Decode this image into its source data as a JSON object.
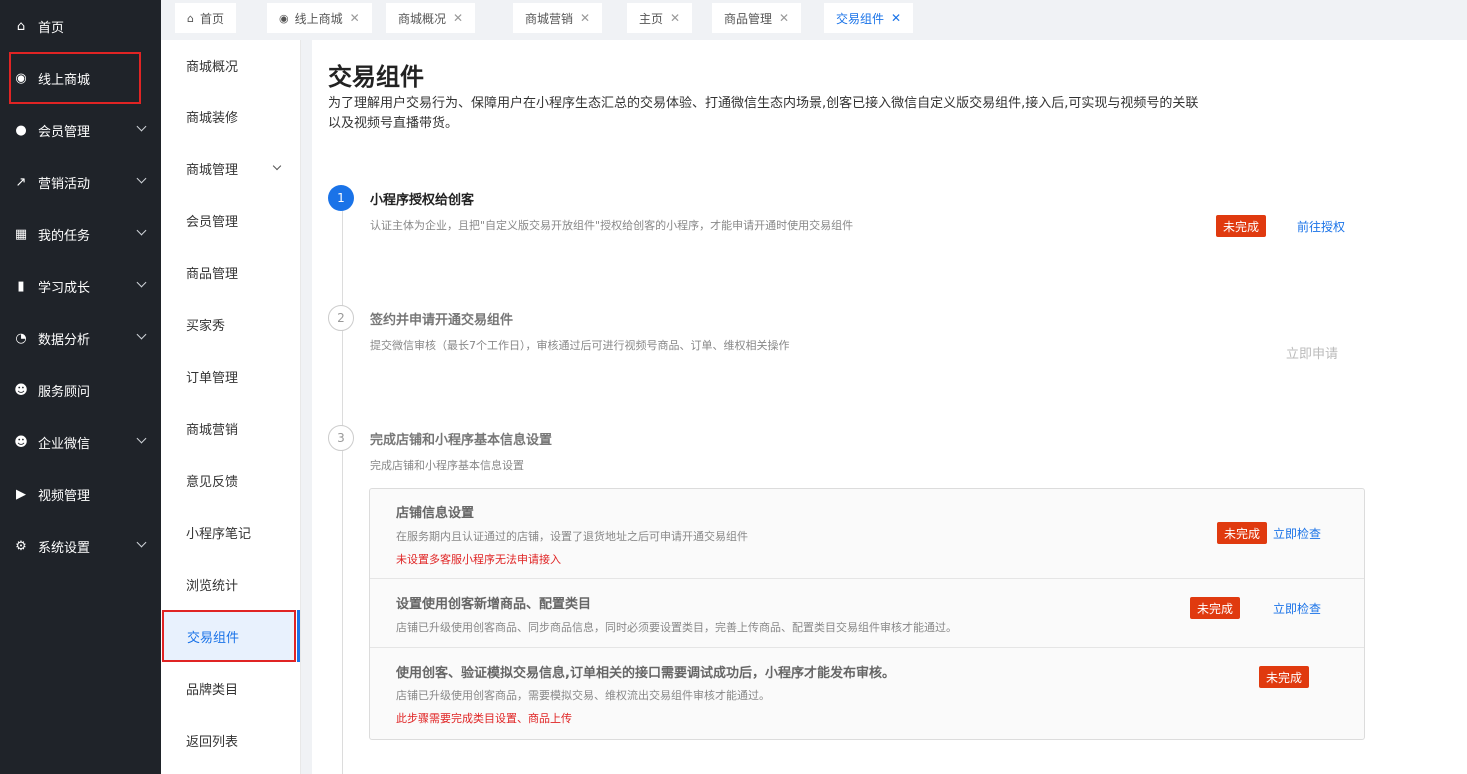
{
  "nav1": [
    {
      "label": "首页",
      "icon": "home-icon"
    },
    {
      "label": "线上商城",
      "icon": "store-icon"
    },
    {
      "label": "会员管理",
      "icon": "user-icon"
    },
    {
      "label": "营销活动",
      "icon": "trend-icon"
    },
    {
      "label": "我的任务",
      "icon": "grid-icon"
    },
    {
      "label": "学习成长",
      "icon": "book-icon"
    },
    {
      "label": "数据分析",
      "icon": "pie-icon"
    },
    {
      "label": "服务顾问",
      "icon": "people-icon"
    },
    {
      "label": "企业微信",
      "icon": "people-icon"
    },
    {
      "label": "视频管理",
      "icon": "video-icon"
    },
    {
      "label": "系统设置",
      "icon": "gear-icon"
    }
  ],
  "nav2": [
    "商城概况",
    "商城装修",
    "商城管理",
    "会员管理",
    "商品管理",
    "买家秀",
    "订单管理",
    "商城营销",
    "意见反馈",
    "小程序笔记",
    "浏览统计",
    "交易组件",
    "品牌类目",
    "返回列表"
  ],
  "tabs": [
    "首页",
    "线上商城",
    "商城概况",
    "商城营销",
    "主页",
    "商品管理",
    "交易组件"
  ],
  "page": {
    "title": "交易组件",
    "desc": "为了理解用户交易行为、保障用户在小程序生态汇总的交易体验、打通微信生态内场景,创客已接入微信自定义版交易组件,接入后,可实现与视频号的关联以及视频号直播带货。"
  },
  "steps": [
    {
      "num": "1",
      "title": "小程序授权给创客",
      "sub": "认证主体为企业，且把\"自定义版交易开放组件\"授权给创客的小程序，才能申请开通时使用交易组件",
      "badge": "未完成",
      "link": "前往授权"
    },
    {
      "num": "2",
      "title": "签约并申请开通交易组件",
      "sub": "提交微信审核（最长7个工作日），审核通过后可进行视频号商品、订单、维权相关操作",
      "link": "立即申请"
    },
    {
      "num": "3",
      "title": "完成店铺和小程序基本信息设置",
      "sub": "完成店铺和小程序基本信息设置"
    }
  ],
  "rows": [
    {
      "title": "店铺信息设置",
      "sub": "在服务期内且认证通过的店铺，设置了退货地址之后可申请开通交易组件",
      "warn": "未设置多客服小程序无法申请接入",
      "badge": "未完成",
      "link": "立即检查"
    },
    {
      "title": "设置使用创客新增商品、配置类目",
      "sub": "店铺已升级使用创客商品、同步商品信息，同时必须要设置类目，完善上传商品、配置类目交易组件审核才能通过。",
      "badge": "未完成",
      "link": "立即检查"
    },
    {
      "title": "使用创客、验证模拟交易信息,订单相关的接口需要调试成功后，小程序才能发布审核。",
      "sub": "店铺已升级使用创客商品，需要模拟交易、维权流出交易组件审核才能通过。",
      "warn": "此步骤需要完成类目设置、商品上传",
      "badge": "未完成"
    }
  ],
  "colors": {
    "accent": "#1a73e8",
    "danger": "#e03a0f",
    "sidebar": "#1f2329"
  }
}
